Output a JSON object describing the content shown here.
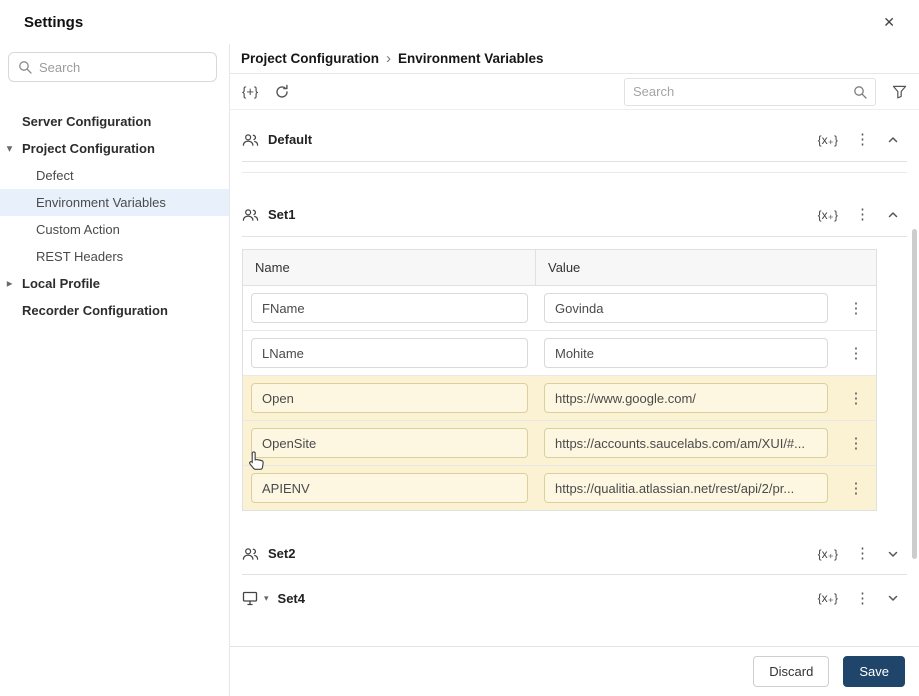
{
  "window": {
    "title": "Settings"
  },
  "icons": {
    "close": "✕",
    "caret_down": "▾",
    "caret_right": "▸",
    "kebab": "⋮",
    "add": "{+}",
    "variables": "{x₊}",
    "breadcrumb_sep": "›"
  },
  "sidebar": {
    "search_placeholder": "Search",
    "items": [
      {
        "label": "Server Configuration"
      },
      {
        "label": "Project Configuration"
      },
      {
        "label": "Defect"
      },
      {
        "label": "Environment Variables"
      },
      {
        "label": "Custom Action"
      },
      {
        "label": "REST Headers"
      },
      {
        "label": "Local Profile"
      },
      {
        "label": "Recorder Configuration"
      }
    ]
  },
  "breadcrumb": {
    "parent": "Project Configuration",
    "current": "Environment Variables"
  },
  "toolbar": {
    "search_placeholder": "Search"
  },
  "sections": {
    "default": {
      "name": "Default"
    },
    "set1": {
      "name": "Set1"
    },
    "set2": {
      "name": "Set2"
    },
    "set4": {
      "name": "Set4"
    }
  },
  "table": {
    "columns": {
      "name": "Name",
      "value": "Value"
    },
    "rows": [
      {
        "name": "FName",
        "value": "Govinda"
      },
      {
        "name": "LName",
        "value": "Mohite"
      },
      {
        "name": "Open",
        "value": "https://www.google.com/"
      },
      {
        "name": "OpenSite",
        "value": "https://accounts.saucelabs.com/am/XUI/#..."
      },
      {
        "name": "APIENV",
        "value": "https://qualitia.atlassian.net/rest/api/2/pr..."
      }
    ]
  },
  "footer": {
    "discard": "Discard",
    "save": "Save"
  },
  "colors": {
    "selected_item_bg": "#e8f1fb",
    "highlight_row_bg": "#faf2d2",
    "save_button_bg": "#20456a"
  }
}
